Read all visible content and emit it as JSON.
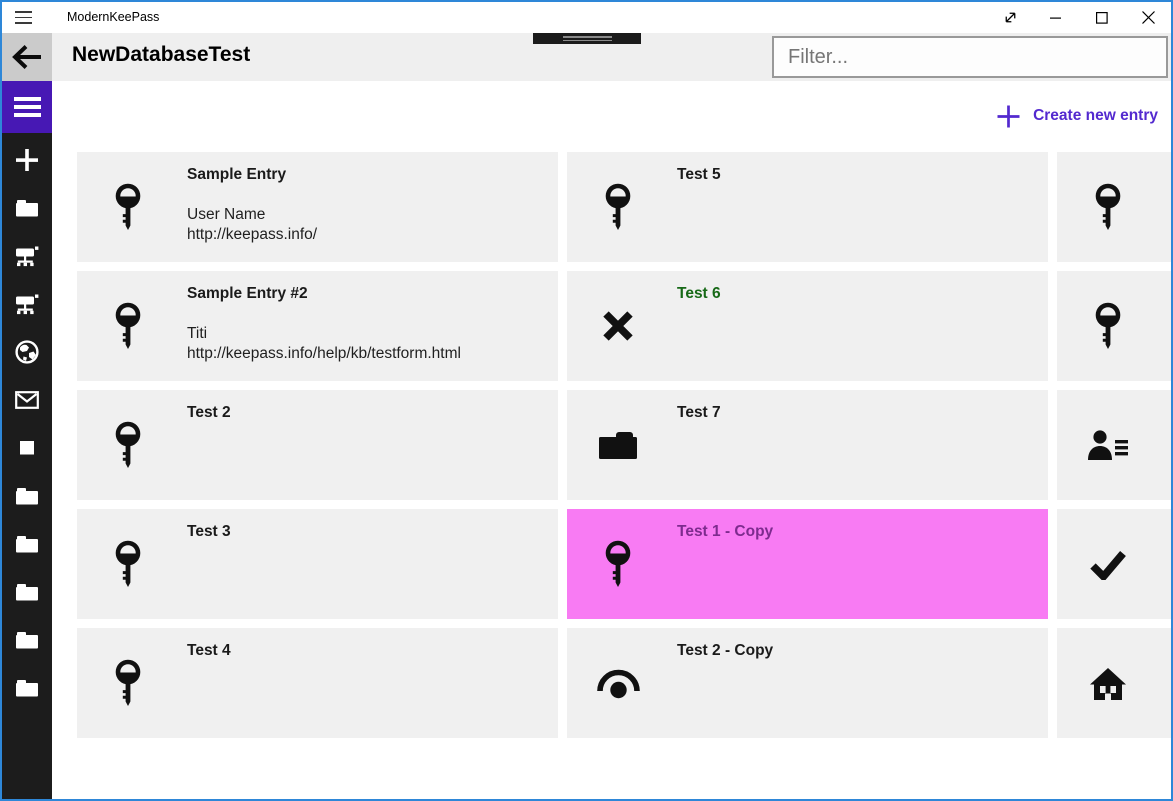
{
  "window": {
    "app_title": "ModernKeePass",
    "border_color": "#2e87d8",
    "controls": [
      {
        "name": "fullscreen",
        "icon": "fullscreen-icon"
      },
      {
        "name": "minimize",
        "icon": "minimize-icon"
      },
      {
        "name": "maximize",
        "icon": "maximize-icon"
      },
      {
        "name": "close",
        "icon": "close-icon"
      }
    ]
  },
  "header": {
    "page_title": "NewDatabaseTest",
    "back_icon": "back-arrow-icon",
    "filter": {
      "placeholder": "Filter...",
      "value": ""
    }
  },
  "toolbar": {
    "create_new_entry_label": "Create new entry",
    "accent_color": "#5329cf"
  },
  "sidebar": {
    "background": "#1c1c1c",
    "menu_button_color": "#4718b4",
    "items": [
      {
        "icon": "add-icon"
      },
      {
        "icon": "folder-icon"
      },
      {
        "icon": "network-icon"
      },
      {
        "icon": "network-icon"
      },
      {
        "icon": "globe-icon"
      },
      {
        "icon": "mail-icon"
      },
      {
        "icon": "square-icon"
      },
      {
        "icon": "folder-icon"
      },
      {
        "icon": "folder-icon"
      },
      {
        "icon": "folder-icon"
      },
      {
        "icon": "folder-icon"
      },
      {
        "icon": "folder-icon"
      }
    ]
  },
  "entries": {
    "column1": [
      {
        "title": "Sample Entry",
        "username": "User Name",
        "url": "http://keepass.info/",
        "icon": "key-icon"
      },
      {
        "title": "Sample Entry #2",
        "username": "Titi",
        "url": "http://keepass.info/help/kb/testform.html",
        "icon": "key-icon"
      },
      {
        "title": "Test 2",
        "icon": "key-icon"
      },
      {
        "title": "Test 3",
        "icon": "key-icon"
      },
      {
        "title": "Test 4",
        "icon": "key-icon"
      }
    ],
    "column2": [
      {
        "title": "Test 5",
        "icon": "key-icon"
      },
      {
        "title": "Test 6",
        "icon": "x-icon",
        "title_color": "#176917"
      },
      {
        "title": "Test 7",
        "icon": "folder-icon"
      },
      {
        "title": "Test 1 - Copy",
        "icon": "key-icon",
        "selected": true,
        "selected_bg": "#f87bf3",
        "title_color": "#7d2b8e"
      },
      {
        "title": "Test 2 - Copy",
        "icon": "view-icon"
      }
    ],
    "column3": [
      {
        "icon": "key-icon"
      },
      {
        "icon": "key-icon"
      },
      {
        "icon": "contact-info-icon"
      },
      {
        "icon": "check-icon"
      },
      {
        "icon": "home-icon"
      }
    ]
  }
}
